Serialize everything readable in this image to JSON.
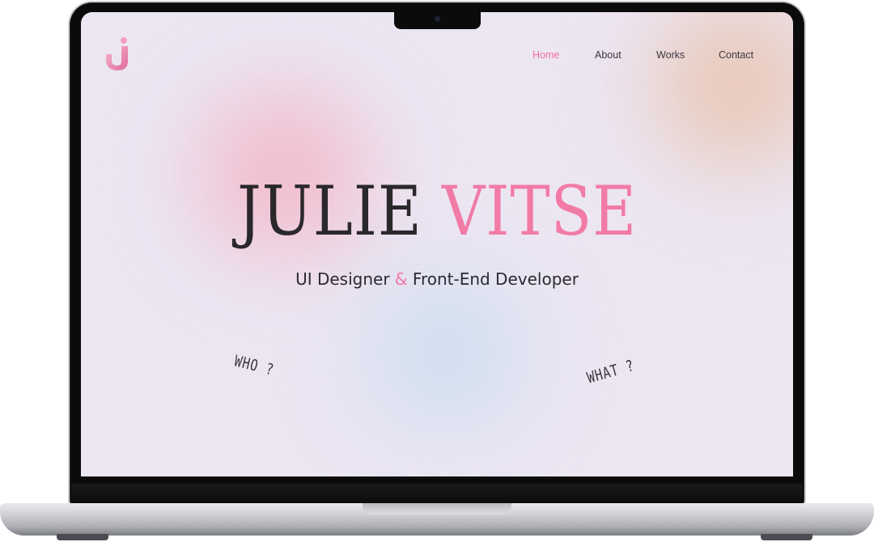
{
  "logo": {
    "icon": "j-monogram-icon"
  },
  "nav": {
    "items": [
      {
        "label": "Home",
        "active": true
      },
      {
        "label": "About",
        "active": false
      },
      {
        "label": "Works",
        "active": false
      },
      {
        "label": "Contact",
        "active": false
      }
    ]
  },
  "hero": {
    "first_name": "JULIE",
    "last_name": "VITSE",
    "role_primary": "UI Designer",
    "ampersand": "&",
    "role_secondary": "Front-End Developer"
  },
  "notes": {
    "who": "WHO ?",
    "what": "WHAT ?"
  },
  "colors": {
    "accent": "#f27ba6",
    "text": "#2b282c",
    "background": "#ece6f3"
  }
}
